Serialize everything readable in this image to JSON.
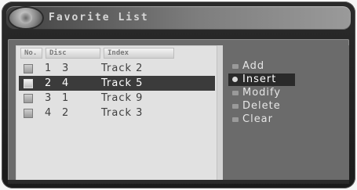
{
  "title": "Favorite List",
  "list": {
    "headers": [
      "No.",
      "Disc",
      "Index"
    ],
    "rows": [
      {
        "no": "1",
        "disc": "3",
        "track": "Track  2",
        "selected": false
      },
      {
        "no": "2",
        "disc": "4",
        "track": "Track  5",
        "selected": true
      },
      {
        "no": "3",
        "disc": "1",
        "track": "Track  9",
        "selected": false
      },
      {
        "no": "4",
        "disc": "2",
        "track": "Track  3",
        "selected": false
      }
    ]
  },
  "menu": {
    "items": [
      "Add",
      "Insert",
      "Modify",
      "Delete",
      "Clear"
    ],
    "highlighted_index": 1
  },
  "colors": {
    "selection_bg": "#3b3b3b",
    "panel_bg": "#e1e1e1",
    "menu_bg": "#6b6b6b"
  }
}
